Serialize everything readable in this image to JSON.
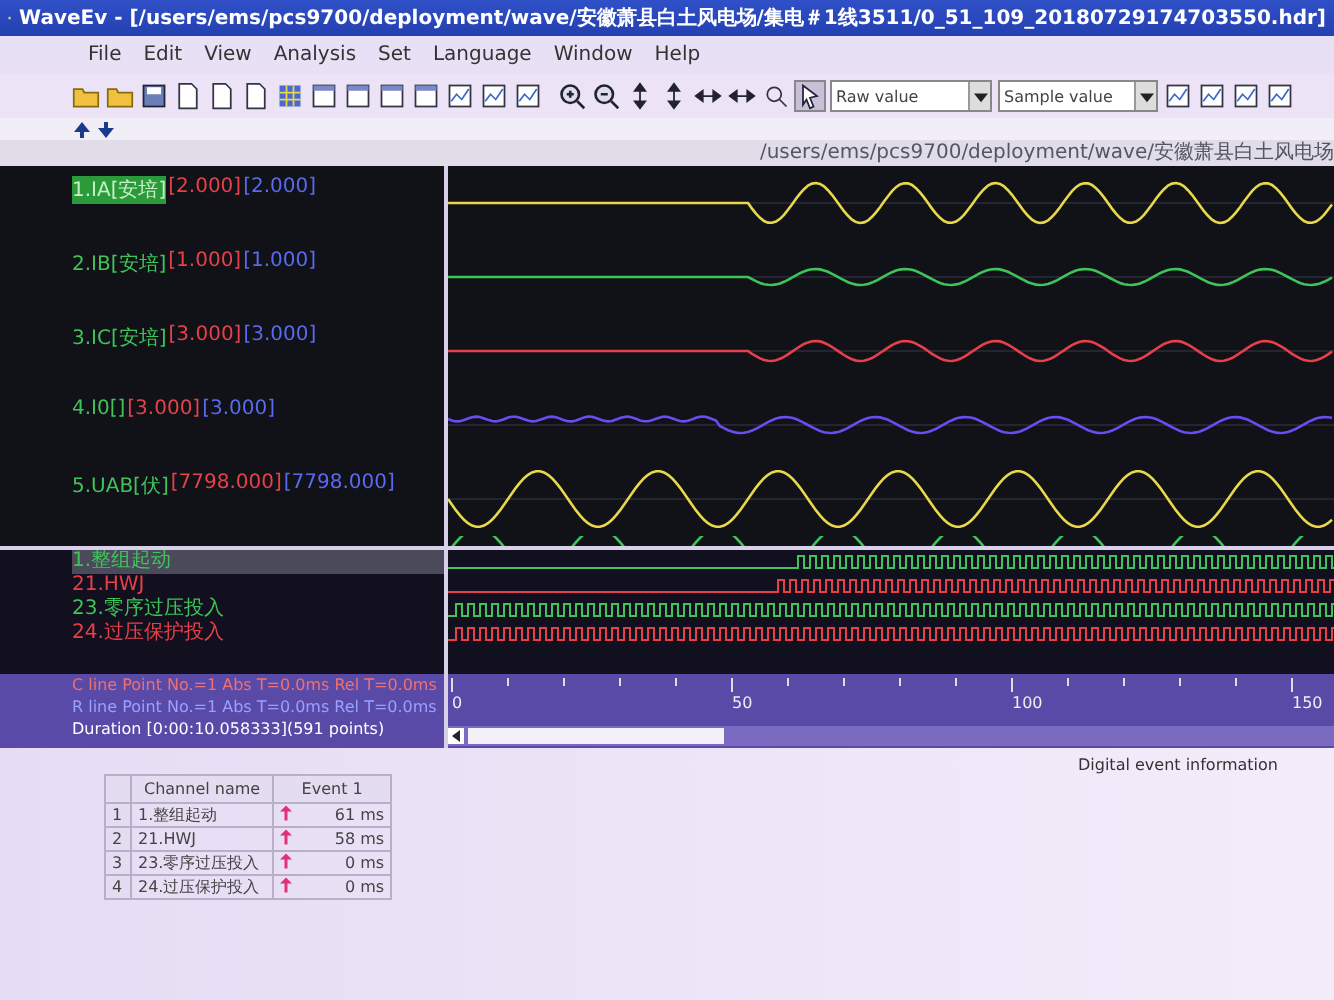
{
  "window": {
    "title": "WaveEv - [/users/ems/pcs9700/deployment/wave/安徽萧县白土风电场/集电＃1线3511/0_51_109_20180729174703550.hdr]"
  },
  "menu": [
    "File",
    "Edit",
    "View",
    "Analysis",
    "Set",
    "Language",
    "Window",
    "Help"
  ],
  "toolbar": {
    "value_mode": "Raw value",
    "sample_mode": "Sample value"
  },
  "path": "/users/ems/pcs9700/deployment/wave/安徽萧县白土风电场",
  "analog_channels": [
    {
      "name": "1.IA[安培]",
      "value_1": "[2.000]",
      "value_2": "[2.000]",
      "selected": true,
      "color": "#e8d84a"
    },
    {
      "name": "2.IB[安培]",
      "value_1": "[1.000]",
      "value_2": "[1.000]",
      "selected": false,
      "color": "#3fc45a"
    },
    {
      "name": "3.IC[安培]",
      "value_1": "[3.000]",
      "value_2": "[3.000]",
      "selected": false,
      "color": "#e8404a"
    },
    {
      "name": "4.I0[]",
      "value_1": "[3.000]",
      "value_2": "[3.000]",
      "selected": false,
      "color": "#6a4cf0"
    },
    {
      "name": "5.UAB[伏]",
      "value_1": "[7798.000]",
      "value_2": "[7798.000]",
      "selected": false,
      "color": "#e8d84a"
    }
  ],
  "digital_channels": [
    {
      "name": "1.整组起动",
      "selected": true,
      "color": "#3fc45a"
    },
    {
      "name": "21.HWJ",
      "selected": false,
      "color": "#e8404a"
    },
    {
      "name": "23.零序过压投入",
      "selected": false,
      "color": "#3fc45a"
    },
    {
      "name": "24.过压保护投入",
      "selected": false,
      "color": "#e8404a"
    }
  ],
  "status": {
    "c_line": "C line  Point No.=1 Abs T=0.0ms   Rel T=0.0ms",
    "r_line": "R line  Point No.=1 Abs T=0.0ms   Rel T=0.0ms",
    "duration": "Duration [0:00:10.058333](591 points)"
  },
  "ruler": {
    "labels": [
      "0",
      "50",
      "100",
      "150"
    ]
  },
  "event_panel": {
    "title": "Digital event information",
    "columns": [
      "Channel name",
      "Event 1"
    ],
    "rows": [
      {
        "index": "1",
        "channel": "1.整组起动",
        "event": "61 ms"
      },
      {
        "index": "2",
        "channel": "21.HWJ",
        "event": "58 ms"
      },
      {
        "index": "3",
        "channel": "23.零序过压投入",
        "event": "0 ms"
      },
      {
        "index": "4",
        "channel": "24.过压保护投入",
        "event": "0 ms"
      }
    ]
  }
}
